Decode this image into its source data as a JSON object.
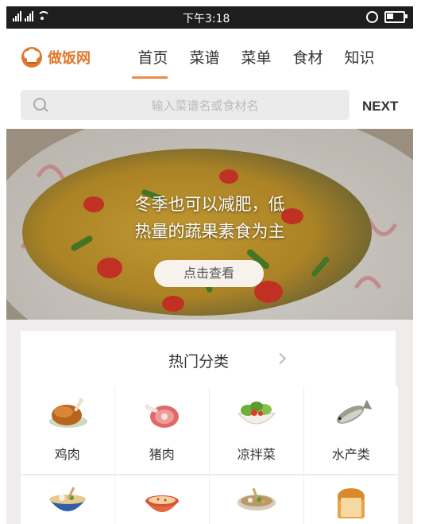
{
  "status_bar": {
    "time": "下午3:18"
  },
  "header": {
    "logo_text": "做饭网",
    "nav": [
      {
        "label": "首页",
        "active": true
      },
      {
        "label": "菜谱",
        "active": false
      },
      {
        "label": "菜单",
        "active": false
      },
      {
        "label": "食材",
        "active": false
      },
      {
        "label": "知识",
        "active": false
      }
    ]
  },
  "search": {
    "placeholder": "输入菜谱名或食材名",
    "next_label": "NEXT"
  },
  "banner": {
    "line1": "冬季也可以减肥，低",
    "line2": "热量的蔬果素食为主",
    "button_label": "点击查看"
  },
  "categories": {
    "title": "热门分类",
    "items": [
      {
        "label": "鸡肉",
        "icon": "roast-chicken-icon"
      },
      {
        "label": "猪肉",
        "icon": "pork-icon"
      },
      {
        "label": "凉拌菜",
        "icon": "salad-icon"
      },
      {
        "label": "水产类",
        "icon": "fish-icon"
      },
      {
        "label": "",
        "icon": "noodle-bowl-icon"
      },
      {
        "label": "",
        "icon": "rice-bowl-icon"
      },
      {
        "label": "",
        "icon": "hotpot-icon"
      },
      {
        "label": "",
        "icon": "bread-icon"
      }
    ]
  },
  "colors": {
    "accent": "#f08a4b",
    "logo": "#e0772c",
    "section_bg": "#f1ecec"
  }
}
